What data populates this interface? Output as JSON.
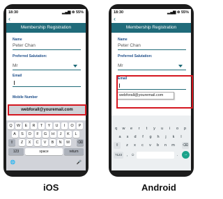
{
  "ios": {
    "caption": "iOS",
    "status": {
      "time": "18:30",
      "signal": "▂▄▆ ⊜ 55%"
    },
    "back_icon": "‹",
    "title": "Membership Registration",
    "form": {
      "name_label": "Name",
      "name_value": "Peter Chan",
      "salutation_label": "Preferred Salutation:",
      "salutation_value": "Mr",
      "email_label": "Email",
      "mobile_label": "Mobile Number"
    },
    "suggestion": "webforall@youremail.com",
    "keyboard": {
      "row1": [
        "Q",
        "W",
        "E",
        "R",
        "T",
        "Y",
        "U",
        "I",
        "O",
        "P"
      ],
      "row2": [
        "A",
        "S",
        "D",
        "F",
        "G",
        "H",
        "J",
        "K",
        "L"
      ],
      "row3": [
        "Z",
        "X",
        "C",
        "V",
        "B",
        "N",
        "M"
      ],
      "shift": "⇧",
      "backspace": "⌫",
      "numbers": "123",
      "space": "space",
      "return": "return",
      "globe": "🌐",
      "mic": "🎤"
    }
  },
  "android": {
    "caption": "Android",
    "status": {
      "time": "18:30",
      "signal": "▂▄▆ ⊜ 55%"
    },
    "back_icon": "‹",
    "title": "Membership Registration",
    "form": {
      "name_label": "Name",
      "name_value": "Peter Chan",
      "salutation_label": "Preferred Salutation:",
      "salutation_value": "Mr",
      "email_label": "Email"
    },
    "suggestion": "webforall@youremail.com",
    "keyboard": {
      "row1": [
        "q",
        "w",
        "e",
        "r",
        "t",
        "y",
        "u",
        "i",
        "o",
        "p"
      ],
      "row2": [
        "a",
        "s",
        "d",
        "f",
        "g",
        "h",
        "j",
        "k",
        "l"
      ],
      "row3": [
        "z",
        "x",
        "c",
        "v",
        "b",
        "n",
        "m"
      ],
      "shift": "⇧",
      "backspace": "⌫",
      "numbers": "?123",
      "comma": ",",
      "period": ".",
      "enter": "→",
      "emoji": "☺"
    }
  },
  "colors": {
    "accent": "#206b7a",
    "highlight": "#d4161f",
    "label": "#1f4f8a"
  }
}
